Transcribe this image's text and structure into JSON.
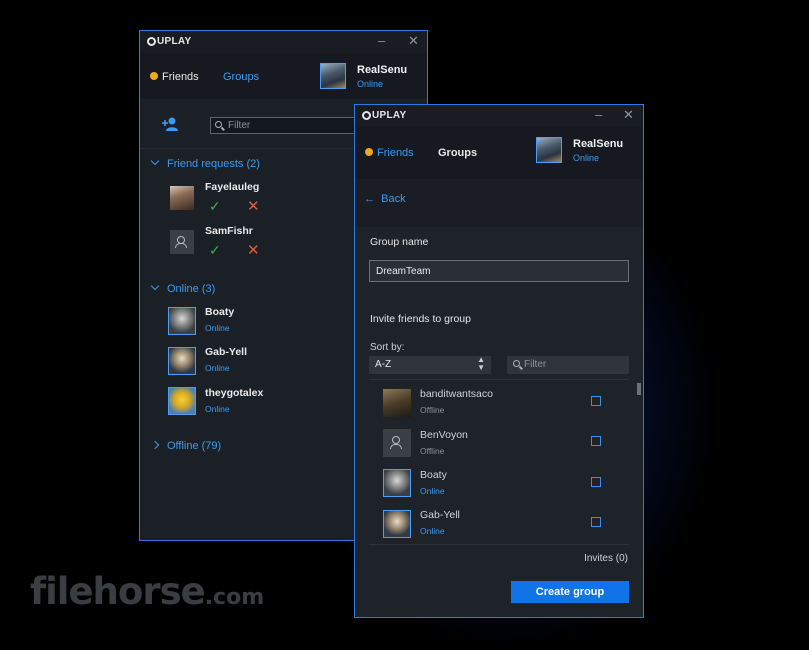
{
  "watermark": {
    "text": "filehorse",
    "suffix": ".com"
  },
  "win1": {
    "brand": "UPLAY",
    "tabs": {
      "friends": "Friends",
      "groups": "Groups"
    },
    "user": {
      "name": "RealSenu",
      "status": "Online"
    },
    "filter_placeholder": "Filter",
    "requests": {
      "title": "Friend requests (2)",
      "items": [
        {
          "name": "Fayelauleg"
        },
        {
          "name": "SamFishr"
        }
      ]
    },
    "online": {
      "title": "Online (3)",
      "items": [
        {
          "name": "Boaty",
          "status": "Online"
        },
        {
          "name": "Gab-Yell",
          "status": "Online"
        },
        {
          "name": "theygotalex",
          "status": "Online"
        }
      ]
    },
    "offline": {
      "title": "Offline (79)"
    }
  },
  "win2": {
    "brand": "UPLAY",
    "tabs": {
      "friends": "Friends",
      "groups": "Groups"
    },
    "user": {
      "name": "RealSenu",
      "status": "Online"
    },
    "back": "Back",
    "group_name_label": "Group name",
    "group_name_value": "DreamTeam",
    "invite_label": "Invite friends to group",
    "sort_label": "Sort by:",
    "sort_value": "A-Z",
    "filter_placeholder": "Filter",
    "friends": [
      {
        "name": "banditwantsaco",
        "status": "Offline"
      },
      {
        "name": "BenVoyon",
        "status": "Offline"
      },
      {
        "name": "Boaty",
        "status": "Online"
      },
      {
        "name": "Gab-Yell",
        "status": "Online"
      }
    ],
    "invites": "Invites (0)",
    "create_button": "Create group"
  },
  "colors": {
    "accent": "#3a9bf2",
    "window_border": "#2a7be8",
    "accept": "#3bb34a",
    "decline": "#e05a3e",
    "online_dot": "#f0a81e",
    "button": "#1173e8"
  }
}
